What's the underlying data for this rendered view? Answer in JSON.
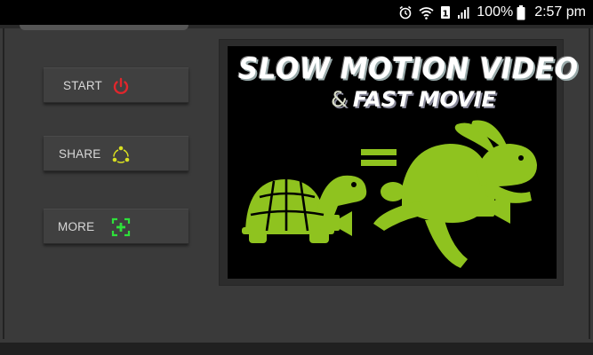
{
  "status_bar": {
    "battery_percent": "100%",
    "time": "2:57 pm",
    "icons": [
      "alarm-icon",
      "wifi-icon",
      "notification-badge-icon",
      "signal-icon",
      "battery-icon"
    ]
  },
  "menu": {
    "start_label": "START",
    "share_label": "SHARE",
    "more_label": "MORE"
  },
  "poster": {
    "title": "SLOW MOTION VIDEO",
    "ampersand": "&",
    "subtitle": "FAST MOVIE",
    "art_color": "#8fc31f"
  },
  "colors": {
    "background": "#3a3a3a",
    "button": "#404040",
    "start_icon": "#e0262c",
    "share_icon": "#d9e020",
    "more_icon": "#2ee03a",
    "poster_art": "#8fc31f"
  }
}
